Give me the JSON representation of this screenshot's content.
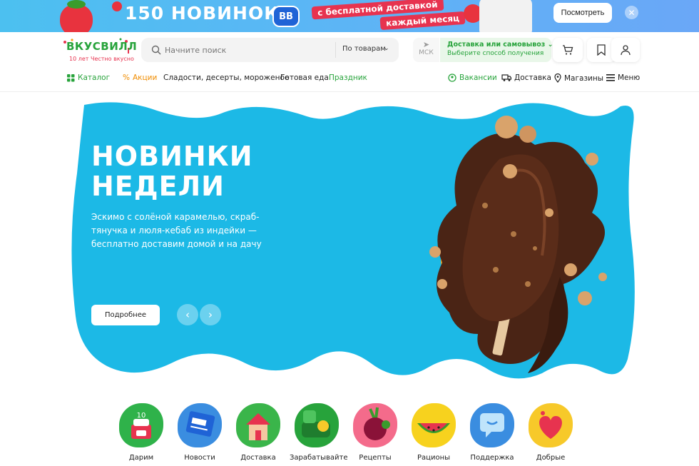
{
  "promo": {
    "title": "150 НОВИНОК",
    "badge": "ВВ",
    "tagline_1": "с бесплатной доставкой",
    "tagline_2": "каждый месяц",
    "button": "Посмотреть",
    "close_icon": "close-icon"
  },
  "header": {
    "logo_word": "ВКУСВИЛЛ",
    "logo_sub": "10 лет Честно вкусно",
    "search": {
      "placeholder": "Начните поиск",
      "scope": "По товарам"
    },
    "location": {
      "city": "МСК"
    },
    "delivery": {
      "title": "Доставка или самовывоз",
      "subtitle": "Выберите способ получения"
    }
  },
  "nav": {
    "catalog": "Каталог",
    "promos": "Акции",
    "sweets": "Сладости, десерты, мороженое",
    "ready_food": "Готовая еда",
    "holiday": "Праздник",
    "vacancies": "Вакансии",
    "delivery": "Доставка",
    "shops": "Магазины",
    "menu": "Меню"
  },
  "hero": {
    "title_1": "НОВИНКИ",
    "title_2": "НЕДЕЛИ",
    "text": "Эскимо с солёной карамелью, скраб-тянучка и люля-кебаб из индейки — бесплатно доставим домой и на дачу",
    "button": "Подробнее",
    "colors": {
      "background": "#1cb9e6",
      "chocolate": "#4a2415",
      "caramel": "#f5a11a"
    }
  },
  "categories": [
    {
      "label": "Дарим",
      "icon": "gift-cake-icon",
      "color": "#2fb24a"
    },
    {
      "label": "Новости",
      "icon": "newspaper-icon",
      "color": "#3a8de0"
    },
    {
      "label": "Доставка",
      "icon": "house-icon",
      "color": "#3ab54a"
    },
    {
      "label": "Зарабатывайте",
      "icon": "coin-wallet-icon",
      "color": "#27a33b"
    },
    {
      "label": "Рецепты",
      "icon": "beet-icon",
      "color": "#f46b8b"
    },
    {
      "label": "Рационы",
      "icon": "watermelon-icon",
      "color": "#f7d21e"
    },
    {
      "label": "Поддержка",
      "icon": "chat-icon",
      "color": "#3a8de0"
    },
    {
      "label": "Добрые",
      "icon": "heart-icon",
      "color": "#f7c92a"
    }
  ]
}
